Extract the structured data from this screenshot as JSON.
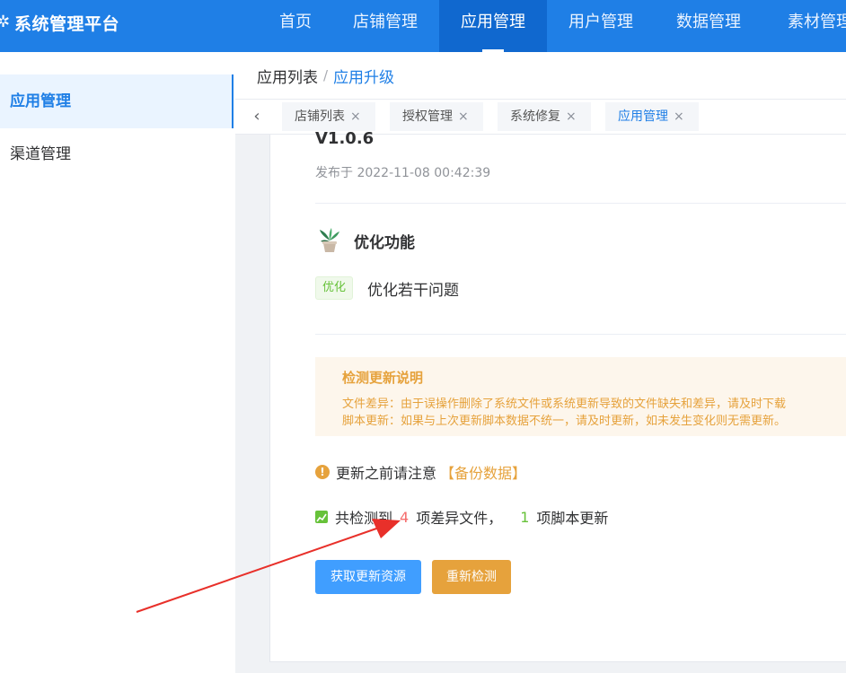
{
  "header": {
    "brand_title": "系统管理平台",
    "nav_items": [
      {
        "label": "首页"
      },
      {
        "label": "店铺管理"
      },
      {
        "label": "应用管理",
        "active": true
      },
      {
        "label": "用户管理"
      },
      {
        "label": "数据管理"
      },
      {
        "label": "素材管理"
      }
    ]
  },
  "sidebar": {
    "items": [
      {
        "label": "应用管理",
        "active": true
      },
      {
        "label": "渠道管理"
      }
    ]
  },
  "breadcrumb": {
    "parent": "应用列表",
    "separator": "/",
    "current": "应用升级"
  },
  "tabs": [
    {
      "label": "店铺列表",
      "close": "×"
    },
    {
      "label": "授权管理",
      "close": "×"
    },
    {
      "label": "系统修复",
      "close": "×"
    },
    {
      "label": "应用管理",
      "close": "×",
      "active": true
    }
  ],
  "release": {
    "version": "V1.0.6",
    "published_at": "发布于 2022-11-08 00:42:39",
    "feature_title": "优化功能",
    "feature_icon": "potted-plant-icon",
    "tag": "优化",
    "description": "优化若干问题"
  },
  "notice": {
    "title": "检测更新说明",
    "line1": "文件差异：由于误操作删除了系统文件或系统更新导致的文件缺失和差异，请及时下载",
    "line2": "脚本更新：如果与上次更新脚本数据不统一，请及时更新，如未发生变化则无需更新。"
  },
  "warning": {
    "text": "更新之前请注意",
    "link": "【备份数据】"
  },
  "detection": {
    "prefix": "共检测到",
    "diff_count": "4",
    "diff_label": "项差异文件，",
    "script_count": "1",
    "script_label": "项脚本更新"
  },
  "actions": {
    "fetch_label": "获取更新资源",
    "recheck_label": "重新检测"
  },
  "colors": {
    "header_bg": "#1f7fe6",
    "accent": "#409eff",
    "warning": "#e6a23c",
    "danger": "#f56c6c",
    "success": "#67c23a",
    "annotation_arrow": "#e8302a"
  }
}
